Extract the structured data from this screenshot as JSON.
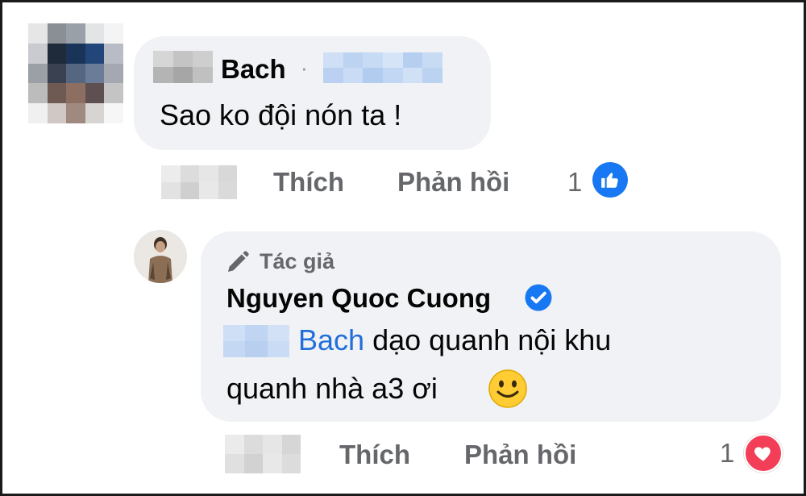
{
  "comment1": {
    "author": "Bach",
    "text": "Sao ko đội nón ta !",
    "actions": {
      "like": "Thích",
      "reply": "Phản hồi"
    },
    "reaction_count": "1",
    "reaction_icon": "thumbs-up-icon",
    "reaction_color": "#1877f2"
  },
  "reply1": {
    "badge": "Tác giả",
    "badge_icon": "pencil-icon",
    "author": "Nguyen Quoc Cuong",
    "verified_icon": "verified-badge-icon",
    "mention": "Bach",
    "text_line1": " dạo quanh nội khu",
    "text_line2": "quanh nhà a3 ơi",
    "emoji": "🙂",
    "actions": {
      "like": "Thích",
      "reply": "Phản hồi"
    },
    "reaction_count": "1",
    "reaction_icon": "heart-icon",
    "reaction_color": "#f33e58"
  }
}
